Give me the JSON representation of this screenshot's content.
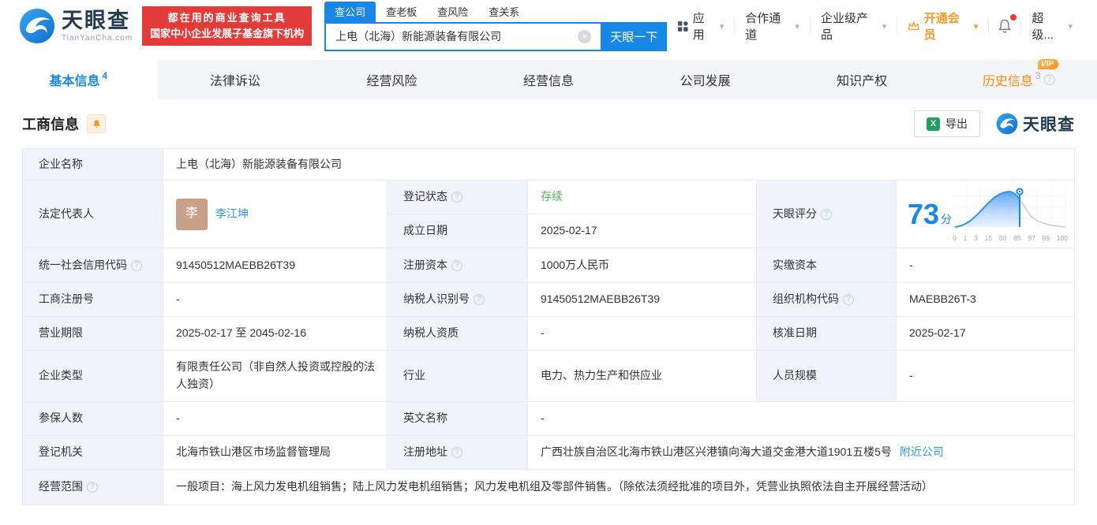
{
  "brand": {
    "logo_text": "天眼查",
    "logo_domain": "TianYanCha.com",
    "banner_line1": "都在用的商业查询工具",
    "banner_line2": "国家中小企业发展子基金旗下机构"
  },
  "search": {
    "tabs": [
      {
        "label": "查公司"
      },
      {
        "label": "查老板"
      },
      {
        "label": "查风险"
      },
      {
        "label": "查关系"
      }
    ],
    "value": "上电（北海）新能源装备有限公司",
    "button": "天眼一下"
  },
  "nav": {
    "apps": "应用",
    "partner": "合作通道",
    "enterprise": "企业级产品",
    "vip": "开通会员",
    "user": "超级..."
  },
  "tabs": [
    {
      "label": "基本信息",
      "badge": "4"
    },
    {
      "label": "法律诉讼"
    },
    {
      "label": "经营风险"
    },
    {
      "label": "经营信息"
    },
    {
      "label": "公司发展"
    },
    {
      "label": "知识产权"
    },
    {
      "label": "历史信息",
      "badge": "3",
      "vip_label": "VIP"
    }
  ],
  "section": {
    "title": "工商信息",
    "export_label": "导出",
    "logo_text": "天眼查"
  },
  "fields": {
    "company_name": {
      "label": "企业名称",
      "value": "上电（北海）新能源装备有限公司"
    },
    "legal_rep": {
      "label": "法定代表人",
      "avatar": "李",
      "value": "李江坤"
    },
    "reg_status": {
      "label": "登记状态",
      "value": "存续"
    },
    "est_date": {
      "label": "成立日期",
      "value": "2025-02-17"
    },
    "score": {
      "label": "天眼评分",
      "value": "73",
      "unit": "分"
    },
    "credit_code": {
      "label": "统一社会信用代码",
      "value": "91450512MAEBB26T39"
    },
    "reg_capital": {
      "label": "注册资本",
      "value": "1000万人民币"
    },
    "paid_capital": {
      "label": "实缴资本",
      "value": "-"
    },
    "reg_number": {
      "label": "工商注册号",
      "value": "-"
    },
    "taxpayer_id": {
      "label": "纳税人识别号",
      "value": "91450512MAEBB26T39"
    },
    "org_code": {
      "label": "组织机构代码",
      "value": "MAEBB26T-3"
    },
    "business_term": {
      "label": "营业期限",
      "value": "2025-02-17 至 2045-02-16"
    },
    "taxpayer_quality": {
      "label": "纳税人资质",
      "value": "-"
    },
    "approval_date": {
      "label": "核准日期",
      "value": "2025-02-17"
    },
    "company_type": {
      "label": "企业类型",
      "value": "有限责任公司（非自然人投资或控股的法人独资）"
    },
    "industry": {
      "label": "行业",
      "value": "电力、热力生产和供应业"
    },
    "staff_size": {
      "label": "人员规模",
      "value": "-"
    },
    "insured_count": {
      "label": "参保人数",
      "value": "-"
    },
    "english_name": {
      "label": "英文名称",
      "value": "-"
    },
    "reg_authority": {
      "label": "登记机关",
      "value": "北海市铁山港区市场监督管理局"
    },
    "reg_address": {
      "label": "注册地址",
      "value": "广西壮族自治区北海市铁山港区兴港镇向海大道交金港大道1901五楼5号",
      "link": "附近公司"
    },
    "business_scope": {
      "label": "经营范围",
      "value": "一般项目：海上风力发电机组销售；陆上风力发电机组销售；风力发电机组及零部件销售。（除依法须经批准的项目外，凭营业执照依法自主开展经营活动）"
    }
  },
  "score_chart": {
    "type": "area",
    "x_ticks": [
      "0",
      "1",
      "3",
      "15",
      "50",
      "85",
      "97",
      "99",
      "100"
    ],
    "marker_value": 73,
    "curve": "percentile bell distribution, filled blue up to score marker"
  },
  "icons": {
    "help_glyph": "?",
    "caret_glyph": "▾",
    "clear_glyph": "×",
    "excel_glyph": "X"
  },
  "colors": {
    "accent_blue": "#1787e8",
    "banner_red": "#e23b3a",
    "vip_orange": "#f59a23",
    "history_orange": "#ff8b17",
    "status_green": "#52b552",
    "label_bg": "#eff4fa"
  }
}
